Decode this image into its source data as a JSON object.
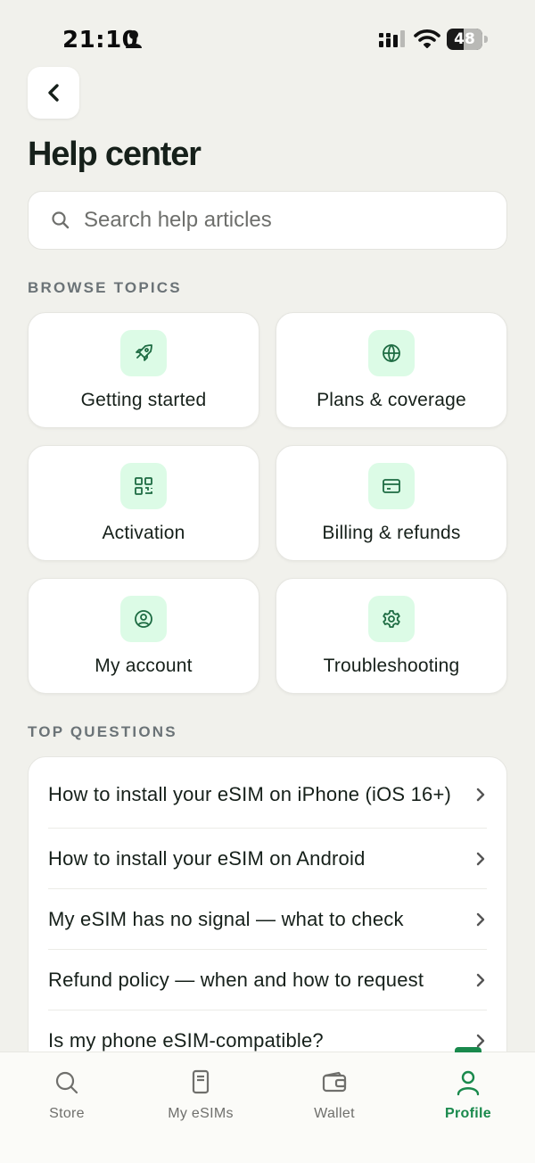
{
  "status_bar": {
    "time": "21:10",
    "battery_level": "48",
    "battery_percent": 48
  },
  "header": {
    "back_icon": "chevron-left-icon",
    "title": "Help center"
  },
  "search": {
    "placeholder": "Search help articles",
    "value": ""
  },
  "browse": {
    "label": "BROWSE TOPICS",
    "topics": [
      {
        "label": "Getting started",
        "icon": "rocket-icon"
      },
      {
        "label": "Plans & coverage",
        "icon": "globe-icon"
      },
      {
        "label": "Activation",
        "icon": "qr-code-icon"
      },
      {
        "label": "Billing & refunds",
        "icon": "credit-card-icon"
      },
      {
        "label": "My account",
        "icon": "user-circle-icon"
      },
      {
        "label": "Troubleshooting",
        "icon": "gear-icon"
      }
    ]
  },
  "top_questions": {
    "label": "TOP QUESTIONS",
    "items": [
      {
        "text": "How to install your eSIM on iPhone (iOS 16+)"
      },
      {
        "text": "How to install your eSIM on Android"
      },
      {
        "text": "My eSIM has no signal — what to check"
      },
      {
        "text": "Refund policy — when and how to request"
      },
      {
        "text": "Is my phone eSIM-compatible?"
      }
    ]
  },
  "tab_bar": {
    "tabs": [
      {
        "label": "Store",
        "icon": "search-icon",
        "active": false
      },
      {
        "label": "My eSIMs",
        "icon": "sim-card-icon",
        "active": false
      },
      {
        "label": "Wallet",
        "icon": "wallet-icon",
        "active": false
      },
      {
        "label": "Profile",
        "icon": "user-icon",
        "active": true
      }
    ]
  },
  "colors": {
    "background": "#f1f1ec",
    "accent": "#19894c",
    "icon_tile": "#dcfbe6",
    "icon_stroke": "#1d6b42",
    "text_primary": "#16201a",
    "text_muted": "#6b7377"
  }
}
